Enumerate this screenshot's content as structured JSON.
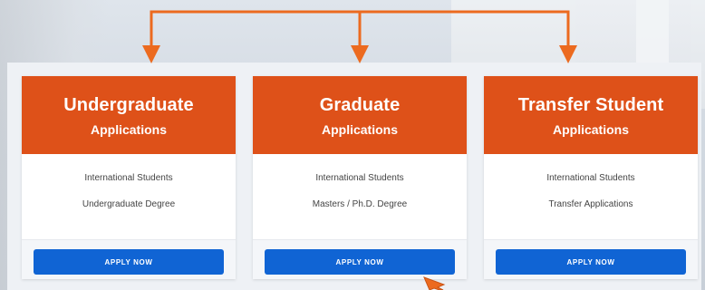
{
  "colors": {
    "accent": "#de5119",
    "arrow": "#ec6a1f",
    "button": "#1064d4",
    "card_background": "#ffffff"
  },
  "cards": [
    {
      "title": "Undergraduate",
      "subtitle": "Applications",
      "lines": [
        "International Students",
        "Undergraduate Degree"
      ],
      "button_label": "APPLY NOW"
    },
    {
      "title": "Graduate",
      "subtitle": "Applications",
      "lines": [
        "International Students",
        "Masters / Ph.D. Degree"
      ],
      "button_label": "APPLY NOW"
    },
    {
      "title": "Transfer Student",
      "subtitle": "Applications",
      "lines": [
        "International Students",
        "Transfer Applications"
      ],
      "button_label": "APPLY NOW"
    }
  ],
  "annotations": {
    "arrow_icons": [
      "down-arrow-icon",
      "down-arrow-icon",
      "down-arrow-icon"
    ],
    "cursor_icon": "pointer-cursor-icon"
  }
}
